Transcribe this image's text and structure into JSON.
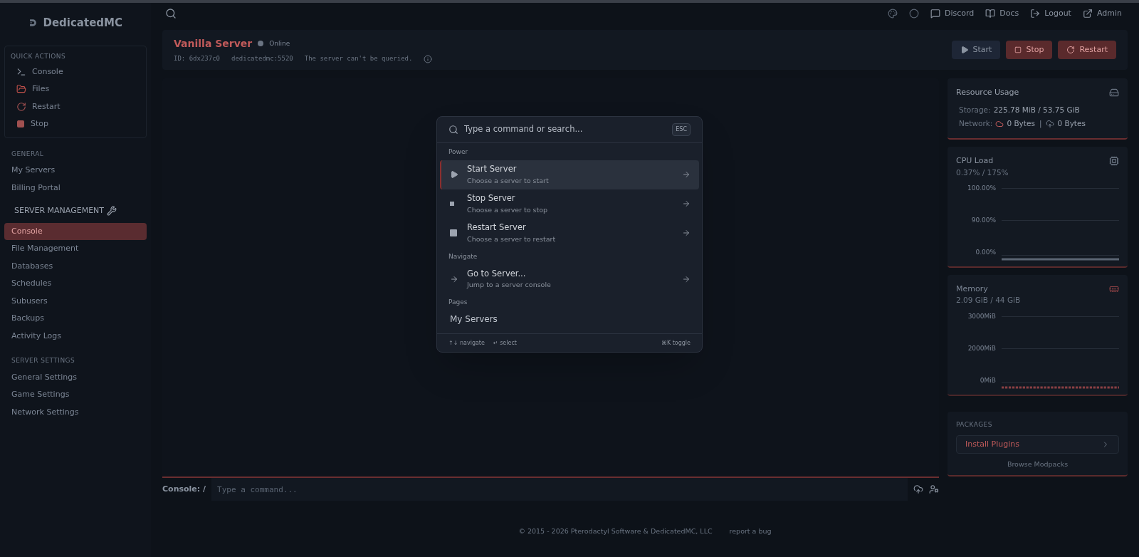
{
  "brand": "DedicatedMC",
  "top_links": [
    "Discord",
    "Docs",
    "Logout",
    "Admin"
  ],
  "sidebar": {
    "quick_actions": {
      "title": "QUICK ACTIONS",
      "items": [
        "Console",
        "Files",
        "Restart",
        "Stop"
      ]
    },
    "general": {
      "title": "GENERAL",
      "items": [
        {
          "label": "My Servers",
          "selected": false
        },
        {
          "label": "Billing Portal",
          "selected": false
        }
      ]
    },
    "management": {
      "title": "SERVER MANAGEMENT",
      "items": [
        {
          "label": "Console",
          "selected": true
        },
        {
          "label": "File Management",
          "selected": false
        },
        {
          "label": "Databases",
          "selected": false
        },
        {
          "label": "Schedules",
          "selected": false
        },
        {
          "label": "Subusers",
          "selected": false
        },
        {
          "label": "Backups",
          "selected": false
        },
        {
          "label": "Activity Logs",
          "selected": false
        }
      ]
    },
    "settings": {
      "title": "SERVER SETTINGS",
      "items": [
        {
          "label": "General Settings",
          "selected": false
        },
        {
          "label": "Game Settings",
          "selected": false
        },
        {
          "label": "Network Settings",
          "selected": false
        }
      ]
    }
  },
  "server": {
    "name": "Vanilla Server",
    "status": "Online",
    "online": true,
    "id": "ID: 6dx237c0",
    "address": "dedicatedmc:5520",
    "query": "The server can't be queried."
  },
  "power_buttons": [
    {
      "kind": "start",
      "label": "Start"
    },
    {
      "kind": "stop",
      "label": "Stop"
    },
    {
      "kind": "restart",
      "label": "Restart"
    }
  ],
  "console": {
    "label": "Console: /",
    "placeholder": "Type a command..."
  },
  "resource": {
    "title": "Resource Usage",
    "storage_label": "Storage:",
    "storage": "225.78 MiB / 53.75 GiB",
    "network_label": "Network:",
    "down": "0 Bytes",
    "separator": "|",
    "up": "0 Bytes"
  },
  "cpu": {
    "title": "CPU Load",
    "value": "0.37% / 175%",
    "y_labels": [
      "100.00%",
      "90.00%",
      "0.00%"
    ]
  },
  "memory": {
    "title": "Memory",
    "value": "2.09 GiB / 44 GiB",
    "y_labels": [
      "3000MiB",
      "2000MiB",
      "0MiB"
    ]
  },
  "packages": {
    "title": "PACKAGES",
    "install": "Install Plugins",
    "browse": "Browse Modpacks"
  },
  "footer": {
    "copyright": "© 2015 - 2026 Pterodactyl Software & DedicatedMC, LLC",
    "report": "report a bug"
  },
  "palette": {
    "placeholder": "Type a command or search...",
    "esc": "ESC",
    "groups": [
      {
        "title": "Power",
        "items": [
          {
            "kind": "start",
            "title": "Start Server",
            "subtitle": "Choose a server to start",
            "selected": true
          },
          {
            "kind": "stop",
            "title": "Stop Server",
            "subtitle": "Choose a server to stop",
            "selected": false
          },
          {
            "kind": "restart",
            "title": "Restart Server",
            "subtitle": "Choose a server to restart",
            "selected": false
          }
        ]
      },
      {
        "title": "Navigate",
        "items": [
          {
            "kind": "goto",
            "title": "Go to Server...",
            "subtitle": "Jump to a server console",
            "selected": false
          }
        ]
      },
      {
        "title": "Pages",
        "items": [
          {
            "kind": "page",
            "title": "My Servers",
            "selected": false
          }
        ]
      }
    ],
    "hints": [
      "↑↓ navigate",
      "↵ select",
      "⌘K toggle"
    ]
  }
}
